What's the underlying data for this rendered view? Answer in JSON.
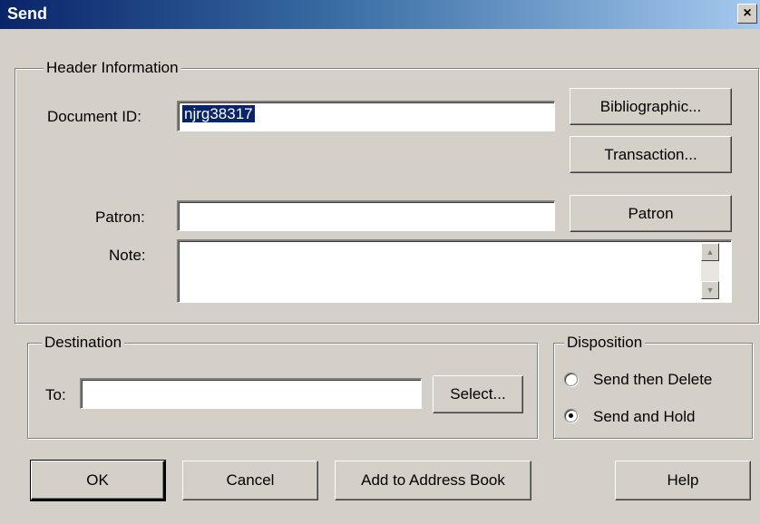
{
  "window": {
    "title": "Send",
    "close_label": "×"
  },
  "header_group": {
    "legend": "Header Information",
    "document_id_label": "Document ID:",
    "document_id_value": "njrg38317",
    "patron_label": "Patron:",
    "patron_value": "",
    "note_label": "Note:",
    "note_value": "",
    "bibliographic_button": "Bibliographic...",
    "transaction_button": "Transaction...",
    "patron_button": "Patron"
  },
  "destination_group": {
    "legend": "Destination",
    "to_label": "To:",
    "to_value": "",
    "select_button": "Select..."
  },
  "disposition_group": {
    "legend": "Disposition",
    "options": [
      {
        "label": "Send then Delete",
        "selected": false
      },
      {
        "label": "Send and Hold",
        "selected": true
      }
    ]
  },
  "buttons": {
    "ok": "OK",
    "cancel": "Cancel",
    "add_to_address_book": "Add to Address Book",
    "help": "Help"
  }
}
